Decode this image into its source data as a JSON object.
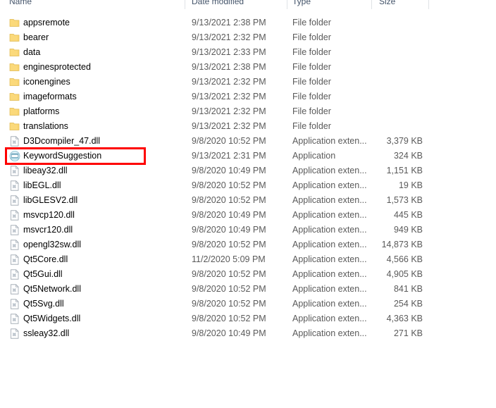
{
  "window": {
    "view_mode": "Details"
  },
  "columns": [
    {
      "key": "name",
      "label": "Name",
      "align": "left"
    },
    {
      "key": "date",
      "label": "Date modified",
      "align": "left"
    },
    {
      "key": "type",
      "label": "Type",
      "align": "left"
    },
    {
      "key": "size",
      "label": "Size",
      "align": "left"
    }
  ],
  "annotation": {
    "target_row": "KeywordSuggestion",
    "color": "#fe0000",
    "shape": "rectangle"
  },
  "rows": [
    {
      "name": "appsremote",
      "date": "9/13/2021 2:38 PM",
      "type": "File folder",
      "size": "",
      "icon": "folder-icon",
      "selected": false
    },
    {
      "name": "bearer",
      "date": "9/13/2021 2:32 PM",
      "type": "File folder",
      "size": "",
      "icon": "folder-icon",
      "selected": false
    },
    {
      "name": "data",
      "date": "9/13/2021 2:33 PM",
      "type": "File folder",
      "size": "",
      "icon": "folder-icon",
      "selected": false
    },
    {
      "name": "enginesprotected",
      "date": "9/13/2021 2:38 PM",
      "type": "File folder",
      "size": "",
      "icon": "folder-icon",
      "selected": false
    },
    {
      "name": "iconengines",
      "date": "9/13/2021 2:32 PM",
      "type": "File folder",
      "size": "",
      "icon": "folder-icon",
      "selected": false
    },
    {
      "name": "imageformats",
      "date": "9/13/2021 2:32 PM",
      "type": "File folder",
      "size": "",
      "icon": "folder-icon",
      "selected": false
    },
    {
      "name": "platforms",
      "date": "9/13/2021 2:32 PM",
      "type": "File folder",
      "size": "",
      "icon": "folder-icon",
      "selected": false
    },
    {
      "name": "translations",
      "date": "9/13/2021 2:32 PM",
      "type": "File folder",
      "size": "",
      "icon": "folder-icon",
      "selected": false
    },
    {
      "name": "D3Dcompiler_47.dll",
      "date": "9/8/2020 10:52 PM",
      "type": "Application exten...",
      "size": "3,379 KB",
      "icon": "dll-file-icon",
      "selected": false
    },
    {
      "name": "KeywordSuggestion",
      "date": "9/13/2021 2:31 PM",
      "type": "Application",
      "size": "324 KB",
      "icon": "application-icon",
      "selected": true
    },
    {
      "name": "libeay32.dll",
      "date": "9/8/2020 10:49 PM",
      "type": "Application exten...",
      "size": "1,151 KB",
      "icon": "dll-file-icon",
      "selected": false
    },
    {
      "name": "libEGL.dll",
      "date": "9/8/2020 10:52 PM",
      "type": "Application exten...",
      "size": "19 KB",
      "icon": "dll-file-icon",
      "selected": false
    },
    {
      "name": "libGLESV2.dll",
      "date": "9/8/2020 10:52 PM",
      "type": "Application exten...",
      "size": "1,573 KB",
      "icon": "dll-file-icon",
      "selected": false
    },
    {
      "name": "msvcp120.dll",
      "date": "9/8/2020 10:49 PM",
      "type": "Application exten...",
      "size": "445 KB",
      "icon": "dll-file-icon",
      "selected": false
    },
    {
      "name": "msvcr120.dll",
      "date": "9/8/2020 10:49 PM",
      "type": "Application exten...",
      "size": "949 KB",
      "icon": "dll-file-icon",
      "selected": false
    },
    {
      "name": "opengl32sw.dll",
      "date": "9/8/2020 10:52 PM",
      "type": "Application exten...",
      "size": "14,873 KB",
      "icon": "dll-file-icon",
      "selected": false
    },
    {
      "name": "Qt5Core.dll",
      "date": "11/2/2020 5:09 PM",
      "type": "Application exten...",
      "size": "4,566 KB",
      "icon": "dll-file-icon",
      "selected": false
    },
    {
      "name": "Qt5Gui.dll",
      "date": "9/8/2020 10:52 PM",
      "type": "Application exten...",
      "size": "4,905 KB",
      "icon": "dll-file-icon",
      "selected": false
    },
    {
      "name": "Qt5Network.dll",
      "date": "9/8/2020 10:52 PM",
      "type": "Application exten...",
      "size": "841 KB",
      "icon": "dll-file-icon",
      "selected": false
    },
    {
      "name": "Qt5Svg.dll",
      "date": "9/8/2020 10:52 PM",
      "type": "Application exten...",
      "size": "254 KB",
      "icon": "dll-file-icon",
      "selected": false
    },
    {
      "name": "Qt5Widgets.dll",
      "date": "9/8/2020 10:52 PM",
      "type": "Application exten...",
      "size": "4,363 KB",
      "icon": "dll-file-icon",
      "selected": false
    },
    {
      "name": "ssleay32.dll",
      "date": "9/8/2020 10:49 PM",
      "type": "Application exten...",
      "size": "271 KB",
      "icon": "dll-file-icon",
      "selected": false
    }
  ]
}
